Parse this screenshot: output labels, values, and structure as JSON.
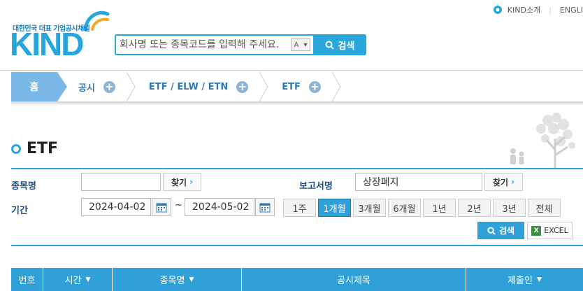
{
  "header": {
    "logo_tagline": "대한민국 대표 기업공시채널",
    "logo_word": "KIND",
    "search": {
      "placeholder": "회사명 또는 종목코드를 입력해 주세요.",
      "autocomplete_label": "A",
      "button_label": "검색"
    },
    "top_links": [
      "KIND소개",
      "ENGLI"
    ]
  },
  "breadcrumb": {
    "home": "홈",
    "items": [
      "공시",
      "ETF / ELW / ETN",
      "ETF"
    ]
  },
  "page_title": "ETF",
  "form": {
    "stock_label": "종목명",
    "stock_value": "",
    "find_label": "찾기",
    "report_label": "보고서명",
    "report_value": "상장폐지",
    "period_label": "기간",
    "date_from": "2024-04-02",
    "date_to": "2024-05-02",
    "date_separator": "~",
    "periods": [
      "1주",
      "1개월",
      "3개월",
      "6개월",
      "1년",
      "2년",
      "3년",
      "전체"
    ],
    "active_period": "1개월",
    "search_label": "검색",
    "excel_label": "EXCEL"
  },
  "table": {
    "columns": [
      "번호",
      "시간",
      "종목명",
      "공시제목",
      "제출인"
    ]
  },
  "colors": {
    "accent": "#29a6dc",
    "breadcrumb_home": "#7ab8e8",
    "label": "#1b4f8a"
  }
}
